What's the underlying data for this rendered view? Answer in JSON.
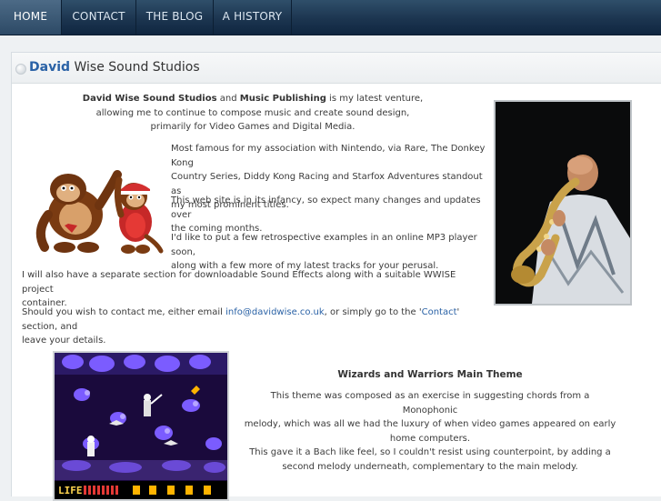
{
  "nav": {
    "items": [
      {
        "label": "HOME"
      },
      {
        "label": "CONTACT"
      },
      {
        "label": "THE BLOG"
      },
      {
        "label": "A HISTORY"
      }
    ]
  },
  "header": {
    "title_accent": "David",
    "title_rest": "Wise Sound Studios"
  },
  "intro": {
    "company": "David Wise Sound Studios",
    "and": "and",
    "publishing": "Music Publishing",
    "line1_rest": "is my latest venture,",
    "line2": "allowing me to continue to compose music and create sound design,",
    "line3": "primarily for Video Games and Digital Media."
  },
  "body": {
    "p1_l1": "Most famous for my association with Nintendo, via Rare, The Donkey Kong",
    "p1_l2": "Country Series, Diddy Kong Racing and Starfox Adventures standout as",
    "p1_l3": "my most prominent titles.",
    "p2_l1": "This web site is in its infancy, so expect many changes and updates over",
    "p2_l2": "the coming months.",
    "p3_l1": "I'd like to put a few retrospective examples in an online MP3 player soon,",
    "p3_l2": "along with a few more of my latest tracks for your perusal.",
    "p4_l1": "I will also have a separate section for downloadable Sound Effects along with a suitable WWISE project",
    "p4_l2": "container.",
    "p5_pre": "Should you wish to contact me, either email ",
    "p5_email": "info@davidwise.co.uk",
    "p5_mid": ", or simply go to the '",
    "p5_contact": "Contact",
    "p5_post": "' section, and",
    "p5_l2": "leave your details."
  },
  "section": {
    "title": "Wizards and Warriors Main Theme",
    "d1_l1": "This theme was composed as an exercise in suggesting chords from a Monophonic",
    "d1_l2": "melody, which was all we had the luxury of when video games appeared on early",
    "d1_l3": "home computers.",
    "d2_l1": "This gave it a Bach like feel, so I couldn't resist using counterpoint, by adding a",
    "d2_l2": "second melody underneath, complementary to the main melody."
  },
  "game": {
    "hud_life": "LIFE"
  },
  "colors": {
    "nav_bg": "#1c3550",
    "accent": "#2a62a6",
    "text": "#3b3b3b"
  }
}
